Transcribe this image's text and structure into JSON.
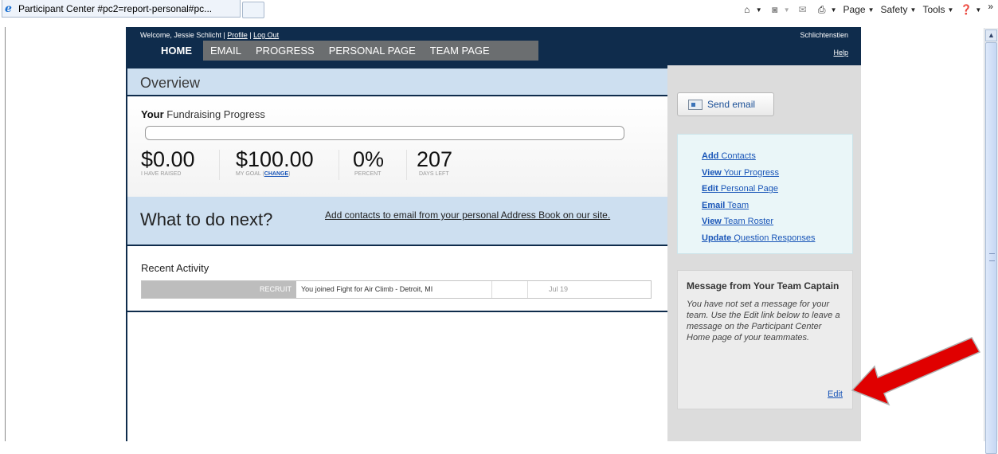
{
  "browser": {
    "tab_title": "Participant Center #pc2=report-personal#pc...",
    "commands": [
      {
        "name": "home",
        "label": ""
      },
      {
        "name": "feeds",
        "label": ""
      },
      {
        "name": "mail",
        "label": ""
      },
      {
        "name": "print",
        "label": ""
      },
      {
        "name": "page",
        "label": "Page"
      },
      {
        "name": "safety",
        "label": "Safety"
      },
      {
        "name": "tools",
        "label": "Tools"
      },
      {
        "name": "help",
        "label": ""
      }
    ],
    "overflow": "»"
  },
  "header": {
    "welcome_prefix": "Welcome, Jessie Schlicht | ",
    "profile": "Profile",
    "sep": " | ",
    "logout": "Log Out",
    "team_name": "Schlichtenstien",
    "help": "Help"
  },
  "nav": {
    "items": [
      "HOME",
      "EMAIL",
      "PROGRESS",
      "PERSONAL PAGE",
      "TEAM PAGE"
    ],
    "active": "HOME"
  },
  "overview": {
    "title": "Overview"
  },
  "progress": {
    "title_bold": "Your",
    "title_rest": " Fundraising Progress",
    "fraction": 0,
    "raised": {
      "value": "$0.00",
      "label": "I HAVE RAISED"
    },
    "goal": {
      "value": "$100.00",
      "label": "MY GOAL (",
      "change": "change",
      "label_end": ")"
    },
    "percent": {
      "value": "0%",
      "label": "PERCENT"
    },
    "days": {
      "value": "207",
      "label": "DAYS LEFT"
    }
  },
  "next": {
    "title": "What to do next?",
    "link": "Add contacts to email from your personal Address Book on our site."
  },
  "recent": {
    "title": "Recent Activity",
    "rows": [
      {
        "tag": "RECRUIT",
        "text": "You joined Fight for Air Climb - Detroit, MI",
        "date": "Jul 19"
      }
    ]
  },
  "sidebar": {
    "send_email": "Send email",
    "links": [
      {
        "bold": "Add",
        "rest": " Contacts"
      },
      {
        "bold": "View",
        "rest": " Your Progress"
      },
      {
        "bold": "Edit",
        "rest": " Personal Page"
      },
      {
        "bold": "Email",
        "rest": " Team"
      },
      {
        "bold": "View",
        "rest": " Team Roster"
      },
      {
        "bold": "Update",
        "rest": " Question Responses"
      }
    ],
    "message": {
      "title": "Message from Your Team Captain",
      "body": "You have not set a message for your team. Use the Edit link below to leave a message on the Participant Center Home page of your teammates.",
      "edit": "Edit"
    }
  },
  "colors": {
    "navy": "#0f2c4c",
    "nav_gray": "#6b6e70",
    "light_blue": "#cddff0",
    "link_blue": "#1a56b8",
    "annotation_red": "#e00000"
  }
}
